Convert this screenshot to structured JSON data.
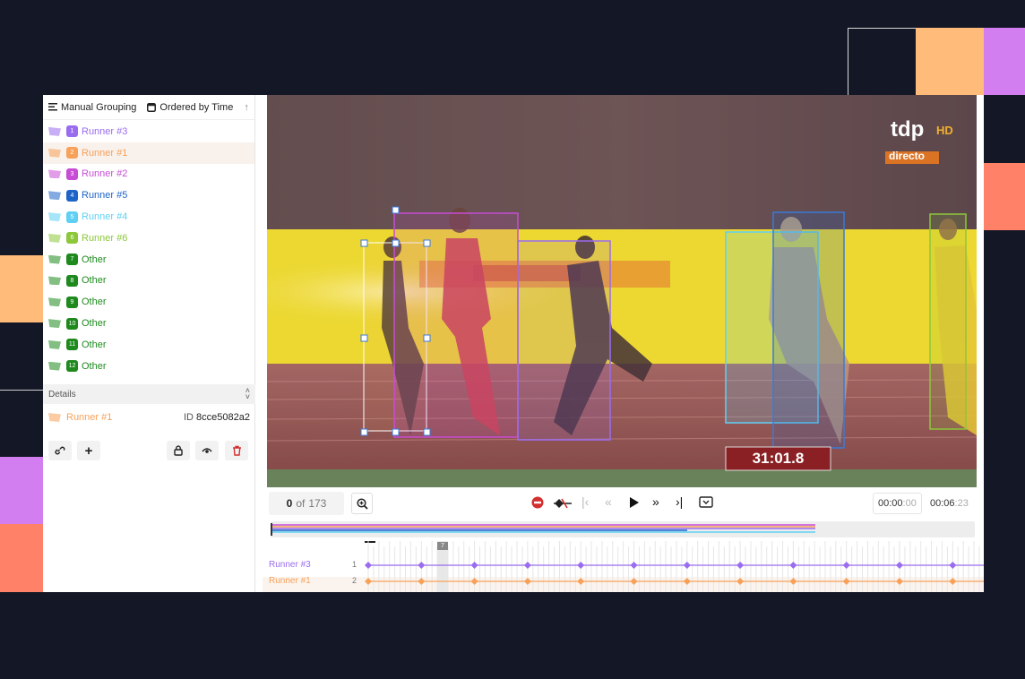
{
  "colors": {
    "background": "#141725",
    "deco_orange": "#ffbb7a",
    "deco_violet": "#d27ef0",
    "deco_coral": "#ff8268",
    "runner1": "#f8a15a",
    "runner2": "#c84cd6",
    "runner3": "#9a6cf0",
    "runner4": "#5fd0f4",
    "runner5": "#1d64c8",
    "runner6": "#8cc83a",
    "other": "#1e8a1e",
    "delete_red": "#d32f2f"
  },
  "toolbar": {
    "grouping_label": "Manual Grouping",
    "ordering_label": "Ordered by Time",
    "grouping_icon": "list-icon",
    "ordering_icon": "clock-square-icon",
    "sort_icon": "arrow-up-icon"
  },
  "labels": [
    {
      "num": "1",
      "name": "Runner #3",
      "color": "#9a6cf0"
    },
    {
      "num": "2",
      "name": "Runner #1",
      "color": "#f8a15a",
      "selected": true
    },
    {
      "num": "3",
      "name": "Runner #2",
      "color": "#c84cd6"
    },
    {
      "num": "4",
      "name": "Runner #5",
      "color": "#1d64c8"
    },
    {
      "num": "5",
      "name": "Runner #4",
      "color": "#5fd0f4"
    },
    {
      "num": "6",
      "name": "Runner #6",
      "color": "#8cc83a"
    },
    {
      "num": "7",
      "name": "Other",
      "color": "#1e8a1e"
    },
    {
      "num": "8",
      "name": "Other",
      "color": "#1e8a1e"
    },
    {
      "num": "9",
      "name": "Other",
      "color": "#1e8a1e"
    },
    {
      "num": "10",
      "name": "Other",
      "color": "#1e8a1e"
    },
    {
      "num": "11",
      "name": "Other",
      "color": "#1e8a1e"
    },
    {
      "num": "12",
      "name": "Other",
      "color": "#1e8a1e"
    }
  ],
  "details": {
    "header": "Details",
    "label_name": "Runner #1",
    "id_prefix": "ID",
    "id_value": "8cce5082a2",
    "actions": [
      "link-icon",
      "plus-icon",
      "lock-icon",
      "eye-icon",
      "trash-icon"
    ]
  },
  "video": {
    "channel_logo": "tdp",
    "channel_hd": "HD",
    "channel_live": "directo",
    "race_clock": "31:01.8"
  },
  "playback": {
    "current_frame": "0",
    "of_label": "of",
    "total_frames": "173",
    "time_current_main": "00:00",
    "time_current_frac": ":00",
    "time_total_main": "00:06",
    "time_total_frac": ":23",
    "timeline_marker": "7"
  },
  "tracks": [
    {
      "name": "Runner #3",
      "num": "1",
      "color": "#9a6cf0"
    },
    {
      "name": "Runner #1",
      "num": "2",
      "color": "#f8a15a"
    }
  ]
}
